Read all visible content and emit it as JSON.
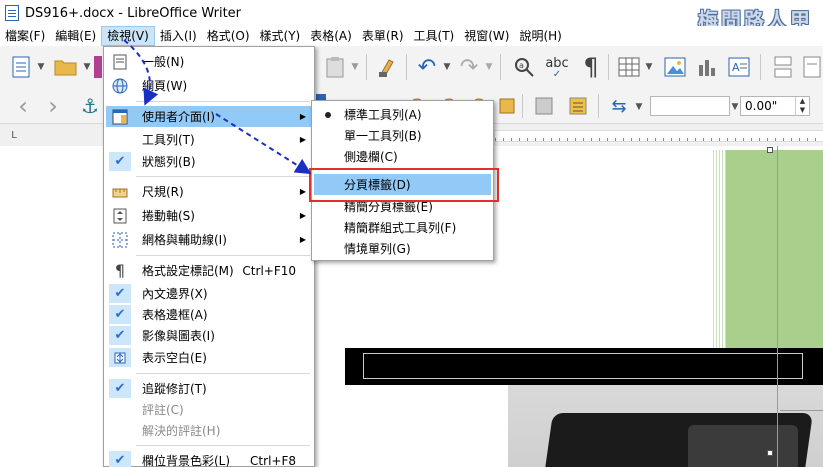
{
  "window": {
    "title": "DS916+.docx - LibreOffice Writer",
    "watermark": "梅問路人甲"
  },
  "menubar": [
    {
      "label": "檔案(F)"
    },
    {
      "label": "編輯(E)"
    },
    {
      "label": "檢視(V)",
      "active": true
    },
    {
      "label": "插入(I)"
    },
    {
      "label": "格式(O)"
    },
    {
      "label": "樣式(Y)"
    },
    {
      "label": "表格(A)"
    },
    {
      "label": "表單(R)"
    },
    {
      "label": "工具(T)"
    },
    {
      "label": "視窗(W)"
    },
    {
      "label": "說明(H)"
    }
  ],
  "toolbar": {
    "spell_label": "abc",
    "spacing_value": "0.00\""
  },
  "view_menu": [
    {
      "label": "一般(N)",
      "icon": "page-icon"
    },
    {
      "label": "網頁(W)",
      "icon": "globe-icon"
    },
    {
      "label": "使用者介面(I)",
      "icon": "ui-layout-icon",
      "submenu": true,
      "highlighted": true
    },
    {
      "label": "工具列(T)",
      "submenu": true
    },
    {
      "label": "狀態列(B)",
      "checked": true
    },
    {
      "label": "尺規(R)",
      "icon": "ruler-icon",
      "submenu": true
    },
    {
      "label": "捲動軸(S)",
      "icon": "scrollbar-icon",
      "submenu": true
    },
    {
      "label": "網格與輔助線(I)",
      "icon": "grid-icon",
      "submenu": true
    },
    {
      "label": "格式設定標記(M)",
      "icon": "pilcrow-icon",
      "shortcut": "Ctrl+F10"
    },
    {
      "label": "內文邊界(X)",
      "checked": true
    },
    {
      "label": "表格邊框(A)",
      "checked": true
    },
    {
      "label": "影像與圖表(I)",
      "checked": true
    },
    {
      "label": "表示空白(E)",
      "icon": "whitespace-icon"
    },
    {
      "label": "追蹤修訂(T)",
      "checked": true
    },
    {
      "label": "評註(C)",
      "disabled": true
    },
    {
      "label": "解決的評註(H)",
      "disabled": true
    },
    {
      "label": "欄位背景色彩(L)",
      "checked": true,
      "shortcut": "Ctrl+F8"
    }
  ],
  "ui_submenu": [
    {
      "label": "標準工具列(A)",
      "selected": true
    },
    {
      "label": "單一工具列(B)"
    },
    {
      "label": "側邊欄(C)"
    },
    {
      "label": "分頁標籤(D)",
      "highlighted": true
    },
    {
      "label": "精簡分頁標籤(E)"
    },
    {
      "label": "精簡群組式工具列(F)"
    },
    {
      "label": "情境單列(G)"
    }
  ],
  "colors": {
    "menu_highlight": "#91c9f7",
    "check_bg": "#cde6fa",
    "annotation_box": "#e0302a",
    "annotation_arrow": "#1a2fc4"
  }
}
